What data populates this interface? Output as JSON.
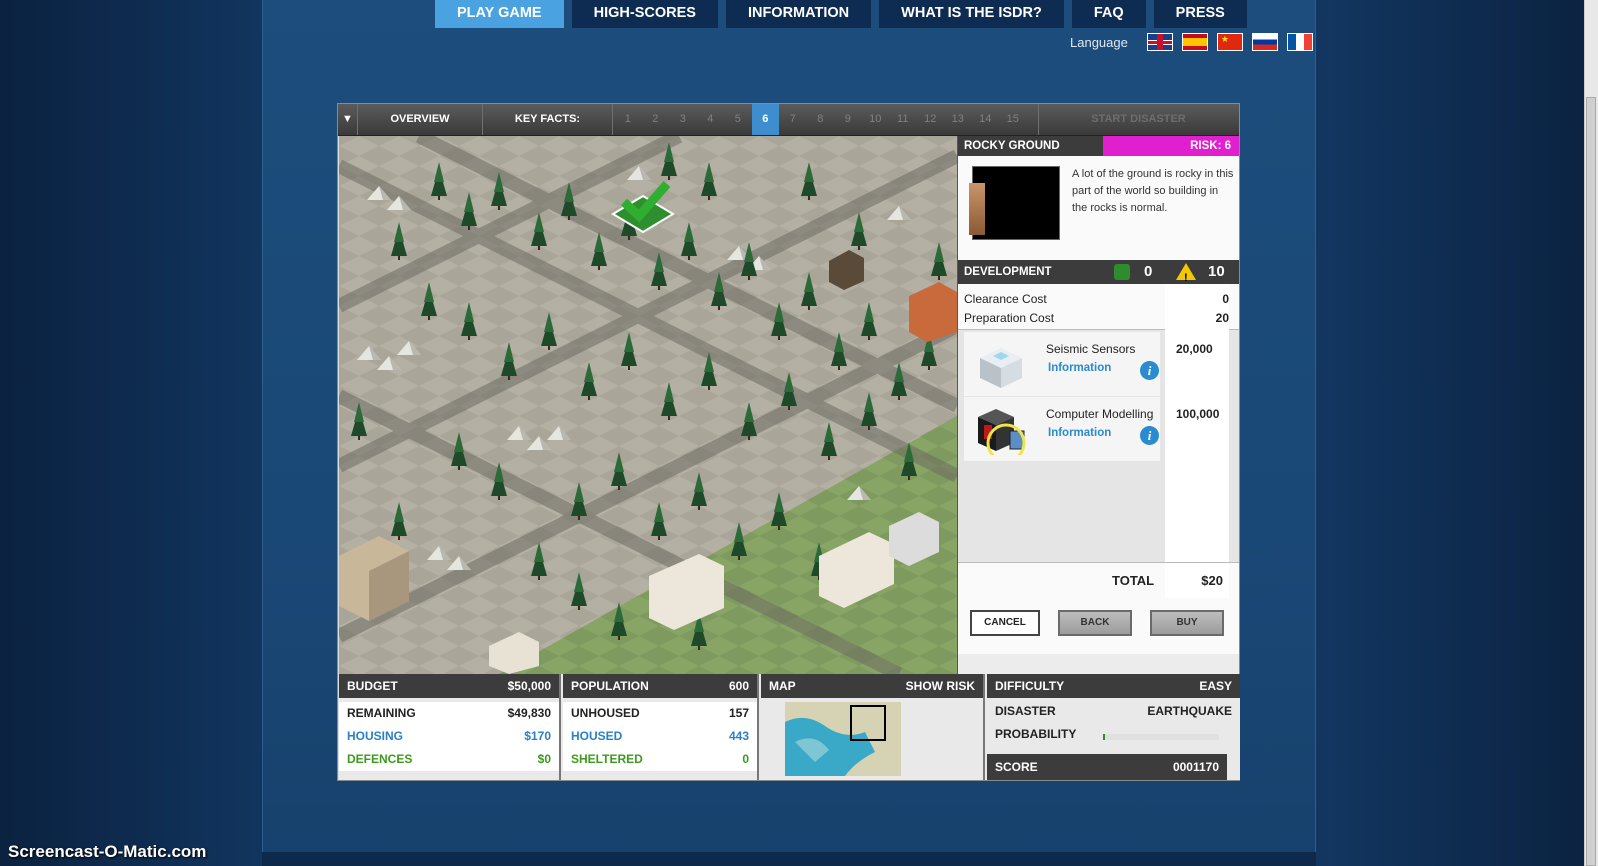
{
  "nav": {
    "tabs": [
      "PLAY GAME",
      "HIGH-SCORES",
      "INFORMATION",
      "WHAT IS THE ISDR?",
      "FAQ",
      "PRESS"
    ],
    "active": "PLAY GAME",
    "language_label": "Language",
    "flags": [
      "uk-flag-icon",
      "spain-flag-icon",
      "china-flag-icon",
      "russia-flag-icon",
      "france-flag-icon"
    ]
  },
  "topbar": {
    "toggle": "▼",
    "overview": "OVERVIEW",
    "key_facts": "KEY FACTS:",
    "facts": [
      "1",
      "2",
      "3",
      "4",
      "5",
      "6",
      "7",
      "8",
      "9",
      "10",
      "11",
      "12",
      "13",
      "14",
      "15"
    ],
    "current_fact": "6",
    "start_disaster": "START DISASTER"
  },
  "panel": {
    "tile_title": "ROCKY GROUND",
    "risk": "RISK: 6",
    "description": "A lot of the ground is rocky in this part of the world so building in the rocks is normal.",
    "development_title": "DEVELOPMENT",
    "dev_people": "0",
    "dev_warnings": "10",
    "clearance_label": "Clearance Cost",
    "clearance_value": "0",
    "preparation_label": "Preparation Cost",
    "preparation_value": "20",
    "items": [
      {
        "name": "Seismic Sensors",
        "info": "Information",
        "price": "20,000",
        "icon": "seismic-sensor-icon"
      },
      {
        "name": "Computer Modelling",
        "info": "Information",
        "price": "100,000",
        "icon": "computer-icon"
      }
    ],
    "total_label": "TOTAL",
    "total_value": "$20",
    "cancel": "CANCEL",
    "back": "BACK",
    "buy": "BUY"
  },
  "hud": {
    "budget": {
      "title": "BUDGET",
      "value": "$50,000",
      "rows": [
        {
          "label": "REMAINING",
          "value": "$49,830"
        },
        {
          "label": "HOUSING",
          "value": "$170"
        },
        {
          "label": "DEFENCES",
          "value": "$0"
        }
      ]
    },
    "population": {
      "title": "POPULATION",
      "value": "600",
      "rows": [
        {
          "label": "UNHOUSED",
          "value": "157"
        },
        {
          "label": "HOUSED",
          "value": "443"
        },
        {
          "label": "SHELTERED",
          "value": "0"
        }
      ]
    },
    "map": {
      "title": "MAP",
      "show_risk": "SHOW RISK"
    },
    "difficulty": {
      "title": "DIFFICULTY",
      "value": "EASY",
      "disaster_label": "DISASTER",
      "disaster_value": "EARTHQUAKE",
      "probability_label": "PROBABILITY",
      "probability_fraction": 0.02,
      "score_label": "SCORE",
      "score_value": "0001170"
    }
  },
  "watermark": "Screencast-O-Matic.com",
  "colors": {
    "active_tab": "#4aa3e0",
    "risk": "#e020cf",
    "link": "#2a8bd0",
    "green": "#3c9a1f"
  }
}
